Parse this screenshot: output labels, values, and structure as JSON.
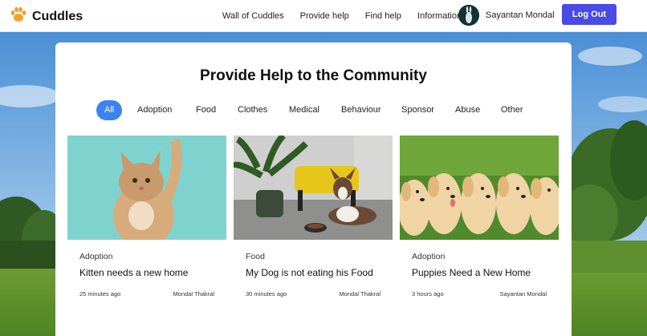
{
  "brand": {
    "name": "Cuddles",
    "logo_icon": "paw-icon",
    "accent": "#f2a227"
  },
  "nav": {
    "links": [
      "Wall of Cuddles",
      "Provide help",
      "Find help",
      "Information"
    ],
    "user_name": "Sayantan Mondal",
    "logout_label": "Log Out",
    "logout_color": "#4a4ae6"
  },
  "page": {
    "title": "Provide Help to the Community",
    "filters": [
      "All",
      "Adoption",
      "Food",
      "Clothes",
      "Medical",
      "Behaviour",
      "Sponsor",
      "Abuse",
      "Other"
    ],
    "active_filter": "All",
    "active_color": "#3c82f0"
  },
  "posts": [
    {
      "category": "Adoption",
      "title": "Kitten needs a new home",
      "time": "25 minutes ago",
      "author": "Mondal Thakral",
      "image": "kitten-photo"
    },
    {
      "category": "Food",
      "title": "My Dog is not eating his Food",
      "time": "30 minutes ago",
      "author": "Mondal Thakral",
      "image": "dog-photo"
    },
    {
      "category": "Adoption",
      "title": "Puppies Need a New Home",
      "time": "3 hours ago",
      "author": "Sayantan Mondal",
      "image": "puppies-photo"
    }
  ]
}
